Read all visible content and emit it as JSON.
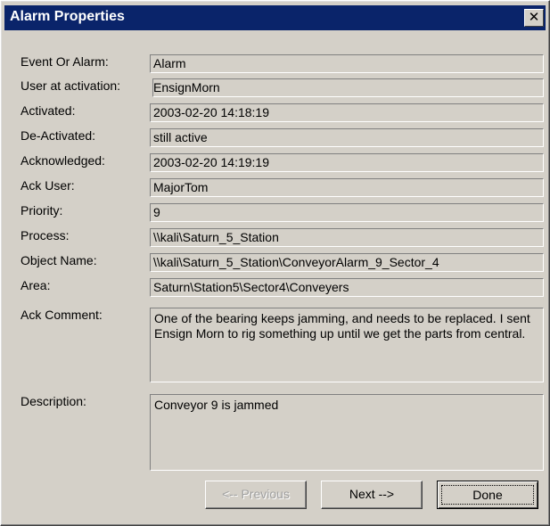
{
  "window": {
    "title": "Alarm Properties",
    "close_glyph": "✕",
    "title_bar_color": "#0a246a"
  },
  "fields": [
    {
      "label": "Event Or Alarm:",
      "value": "Alarm"
    },
    {
      "label": "User at activation:",
      "value": "EnsignMorn"
    },
    {
      "label": "Activated:",
      "value": "2003-02-20 14:18:19"
    },
    {
      "label": "De-Activated:",
      "value": "still active"
    },
    {
      "label": "Acknowledged:",
      "value": "2003-02-20 14:19:19"
    },
    {
      "label": "Ack User:",
      "value": "MajorTom"
    },
    {
      "label": "Priority:",
      "value": "9"
    },
    {
      "label": "Process:",
      "value": "\\\\kali\\Saturn_5_Station"
    },
    {
      "label": "Object Name:",
      "value": "\\\\kali\\Saturn_5_Station\\ConveyorAlarm_9_Sector_4"
    },
    {
      "label": "Area:",
      "value": "Saturn\\Station5\\Sector4\\Conveyers"
    }
  ],
  "ack_comment": {
    "label": "Ack Comment:",
    "value": "One of the bearing keeps jamming, and needs to be replaced. I sent Ensign Morn to rig something up until we get the parts from central."
  },
  "description": {
    "label": "Description:",
    "value": "Conveyor 9 is jammed"
  },
  "buttons": {
    "previous": "<-- Previous",
    "next": "Next -->",
    "done": "Done"
  }
}
